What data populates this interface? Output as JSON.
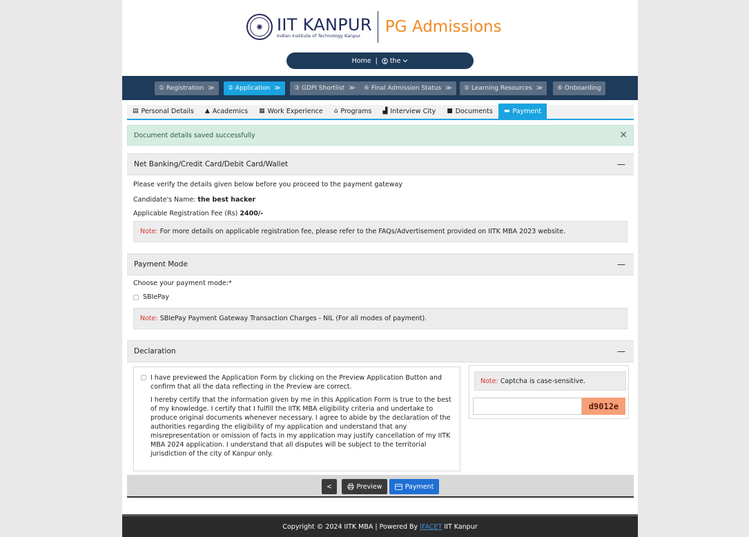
{
  "header": {
    "institute_name": "IIT KANPUR",
    "institute_sub": "Indian Institute of Technology Kanpur",
    "app_title": "PG Admissions"
  },
  "nav": {
    "home": "Home",
    "separator": "|",
    "user": "the"
  },
  "steps": [
    {
      "label": "① Registration"
    },
    {
      "label": "② Application"
    },
    {
      "label": "③ GDPI Shortlist"
    },
    {
      "label": "④ Final Admission Status"
    },
    {
      "label": "⑤ Learning Resources"
    },
    {
      "label": "⑥ Onboarding"
    }
  ],
  "tabs": [
    {
      "label": "Personal Details",
      "icon": "id-card-icon"
    },
    {
      "label": "Academics",
      "icon": "graduation-cap-icon"
    },
    {
      "label": "Work Experience",
      "icon": "briefcase-icon"
    },
    {
      "label": "Programs",
      "icon": "building-icon"
    },
    {
      "label": "Interview City",
      "icon": "city-icon"
    },
    {
      "label": "Documents",
      "icon": "folder-icon"
    },
    {
      "label": "Payment",
      "icon": "card-icon"
    }
  ],
  "alert": {
    "message": "Document details saved successfully"
  },
  "payment_section": {
    "title": "Net Banking/Credit Card/Debit Card/Wallet",
    "verify_text": "Please verify the details given below before you proceed to the payment gateway",
    "candidate_label": "Candidate's Name:",
    "candidate_name": "the best hacker",
    "fee_label": "Applicable Registration Fee (Rs)",
    "fee_value": "2400/-",
    "note_label": "Note:",
    "note_text": "For more details on applicable registration fee, please refer to the FAQs/Advertisement provided on IITK MBA 2023 website."
  },
  "mode_section": {
    "title": "Payment Mode",
    "choose_label": "Choose your payment mode:*",
    "option": "SBIePay",
    "note_label": "Note:",
    "note_text": "SBIePay Payment Gateway Transaction Charges - NIL (For all modes of payment)."
  },
  "declaration_section": {
    "title": "Declaration",
    "check_text": "I have previewed the Application Form by clicking on the Preview Application Button and confirm that all the data reflecting in the Preview are correct.",
    "certify_text": "I hereby certify that the information given by me in this Application Form is true to the best of my knowledge. I certify that I fulfill the IITK MBA eligibility criteria and undertake to produce original documents whenever necessary. I agree to abide by the declaration of the authorities regarding the eligibility of my application and understand that any misrepresentation or omission of facts in my application may justify cancellation of my IITK MBA 2024 application. I understand that all disputes will be subject to the territorial jurisdiction of the city of Kanpur only."
  },
  "captcha": {
    "note_label": "Note:",
    "note_text": "Captcha is case-sensitive.",
    "code": "d9012e",
    "input_value": ""
  },
  "buttons": {
    "back": "<",
    "preview": "Preview",
    "payment": "Payment"
  },
  "footer": {
    "prefix": "Copyright © 2024 IITK MBA | Powered By",
    "link": "IFACET",
    "suffix": "IIT Kanpur"
  },
  "colors": {
    "accent": "#1aa3e0",
    "dark_nav": "#1e3b5a",
    "brand_orange": "#f08a24",
    "note_red": "#d9322f",
    "payment_button": "#1f6fd4"
  }
}
